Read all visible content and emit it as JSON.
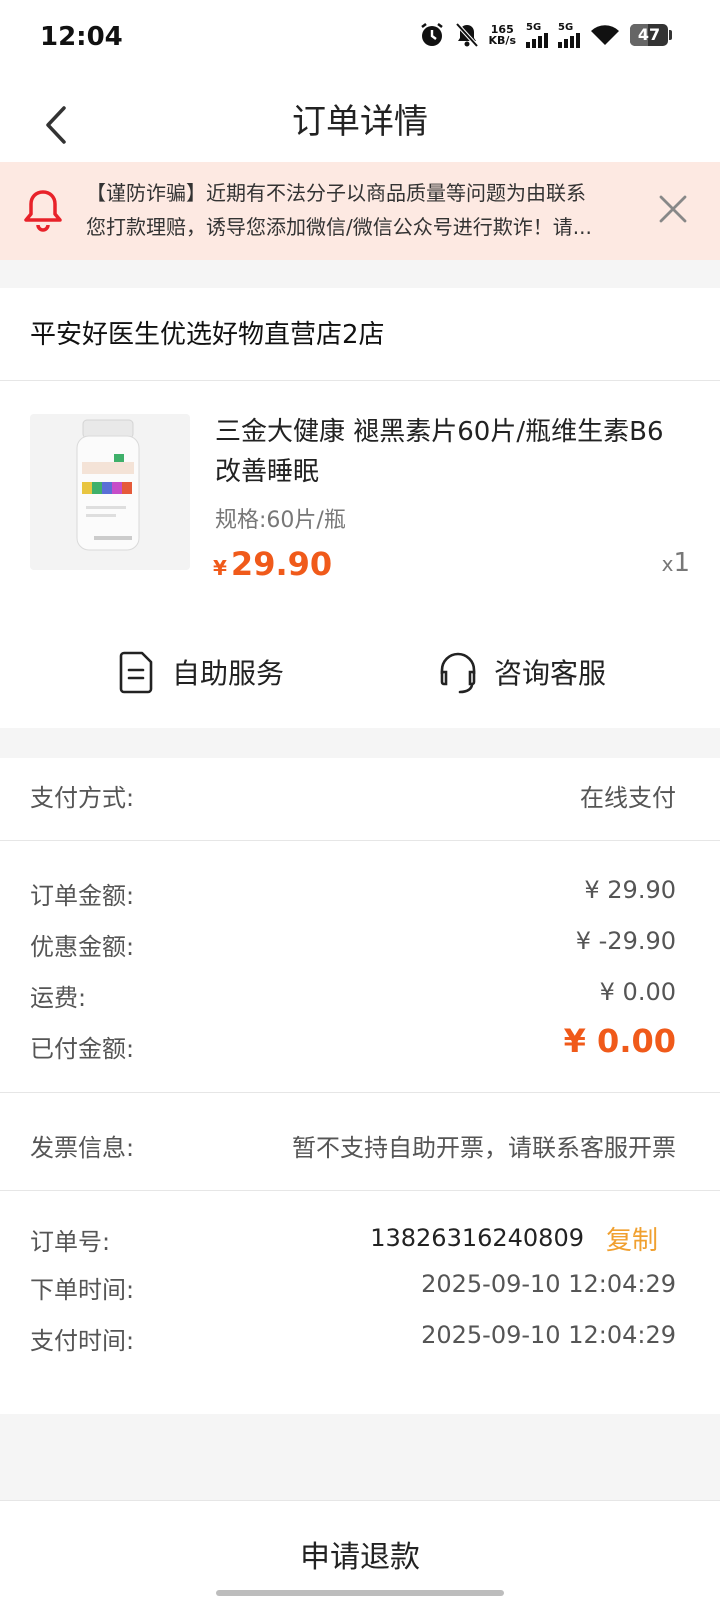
{
  "status": {
    "time": "12:04",
    "speed_value": "165",
    "speed_unit": "KB/s",
    "sig1": "5G",
    "sig2": "5G",
    "battery": "47"
  },
  "nav": {
    "title": "订单详情"
  },
  "notice": {
    "line1": "【谨防诈骗】近期有不法分子以商品质量等问题为由联系",
    "line2": "您打款理赔，诱导您添加微信/微信公众号进行欺诈！请..."
  },
  "store": {
    "name": "平安好医生优选好物直营店2店"
  },
  "product": {
    "name": "三金大健康 褪黑素片60片/瓶维生素B6改善睡眠",
    "spec": "规格:60片/瓶",
    "currency": "¥",
    "price": "29.90",
    "qty_prefix": "x",
    "qty": "1",
    "label_colors": [
      "#e8c540",
      "#3fb06a",
      "#5a6fd6",
      "#c64dc8",
      "#e55a3a"
    ]
  },
  "services": {
    "self_service": "自助服务",
    "customer_service": "咨询客服"
  },
  "payment": {
    "label": "支付方式:",
    "value": "在线支付"
  },
  "amounts": {
    "order_label": "订单金额:",
    "order_value": "¥ 29.90",
    "discount_label": "优惠金额:",
    "discount_value": "¥ -29.90",
    "shipping_label": "运费:",
    "shipping_value": "¥ 0.00",
    "paid_label": "已付金额:",
    "paid_value": "¥ 0.00"
  },
  "invoice": {
    "label": "发票信息:",
    "value": "暂不支持自助开票，请联系客服开票"
  },
  "order": {
    "id_label": "订单号:",
    "id_value": "13826316240809",
    "copy_label": "复制",
    "created_label": "下单时间:",
    "created_value": "2025-09-10 12:04:29",
    "paid_time_label": "支付时间:",
    "paid_time_value": "2025-09-10 12:04:29"
  },
  "bottom": {
    "refund_label": "申请退款"
  },
  "colors": {
    "accent": "#f05a1a",
    "copy": "#f0a030",
    "notice_bg": "#fde9e2",
    "bell": "#e8222a"
  }
}
